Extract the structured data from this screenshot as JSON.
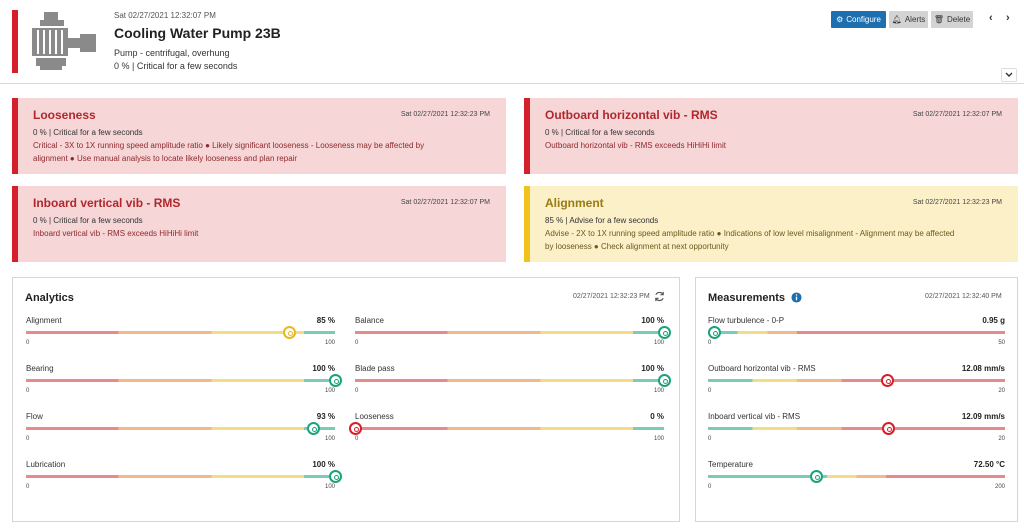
{
  "header": {
    "timestamp": "Sat 02/27/2021 12:32:07 PM",
    "title": "Cooling Water Pump 23B",
    "subtitle": "Pump - centrifugal, overhung",
    "status": "0 % | Critical for a few seconds",
    "configure_label": "Configure",
    "alerts_label": "Alerts",
    "delete_label": "Delete",
    "prev_label": "‹",
    "next_label": "›"
  },
  "alerts": [
    {
      "title": "Looseness",
      "timestamp": "Sat 02/27/2021 12:32:23 PM",
      "status": "0 % | Critical for a few seconds",
      "detail1": "Critical - 3X to 1X running speed amplitude ratio ● Likely significant looseness - Looseness may be affected by",
      "detail2": "alignment ● Use manual analysis to locate likely looseness and plan repair",
      "severity": "critical"
    },
    {
      "title": "Outboard horizontal vib - RMS",
      "timestamp": "Sat 02/27/2021 12:32:07 PM",
      "status": "0 % | Critical for a few seconds",
      "detail1": "Outboard horizontal vib - RMS exceeds HiHiHi limit",
      "detail2": "",
      "severity": "critical"
    },
    {
      "title": "Inboard vertical vib - RMS",
      "timestamp": "Sat 02/27/2021 12:32:07 PM",
      "status": "0 % | Critical for a few seconds",
      "detail1": "Inboard vertical vib - RMS exceeds HiHiHi limit",
      "detail2": "",
      "severity": "critical"
    },
    {
      "title": "Alignment",
      "timestamp": "Sat 02/27/2021 12:32:23 PM",
      "status": "85 % | Advise for a few seconds",
      "detail1": "Advise - 2X to 1X running speed amplitude ratio ● Indications of low level misalignment - Alignment may be affected",
      "detail2": "by looseness ● Check alignment at next opportunity",
      "severity": "advise"
    }
  ],
  "analytics": {
    "title": "Analytics",
    "timestamp": "02/27/2021 12:32:23 PM",
    "gauges": [
      {
        "label": "Alignment",
        "value_text": "85 %",
        "value": 85,
        "min": "0",
        "max": "100",
        "scale_max": 100,
        "knob": "yellow",
        "track": "health"
      },
      {
        "label": "Balance",
        "value_text": "100 %",
        "value": 100,
        "min": "0",
        "max": "100",
        "scale_max": 100,
        "knob": "green",
        "track": "health"
      },
      {
        "label": "Bearing",
        "value_text": "100 %",
        "value": 100,
        "min": "0",
        "max": "100",
        "scale_max": 100,
        "knob": "green",
        "track": "health"
      },
      {
        "label": "Blade pass",
        "value_text": "100 %",
        "value": 100,
        "min": "0",
        "max": "100",
        "scale_max": 100,
        "knob": "green",
        "track": "health"
      },
      {
        "label": "Flow",
        "value_text": "93 %",
        "value": 93,
        "min": "0",
        "max": "100",
        "scale_max": 100,
        "knob": "green",
        "track": "health"
      },
      {
        "label": "Looseness",
        "value_text": "0 %",
        "value": 0,
        "min": "0",
        "max": "100",
        "scale_max": 100,
        "knob": "red",
        "track": "health"
      },
      {
        "label": "Lubrication",
        "value_text": "100 %",
        "value": 100,
        "min": "0",
        "max": "100",
        "scale_max": 100,
        "knob": "green",
        "track": "health"
      }
    ]
  },
  "measurements": {
    "title": "Measurements",
    "timestamp": "02/27/2021 12:32:40 PM",
    "gauges": [
      {
        "label": "Flow turbulence - 0-P",
        "value_text": "0.95 g",
        "value": 0.95,
        "min": "0",
        "max": "50",
        "scale_max": 50,
        "knob": "green",
        "track": "flow"
      },
      {
        "label": "Outboard horizontal vib - RMS",
        "value_text": "12.08 mm/s",
        "value": 12.08,
        "min": "0",
        "max": "20",
        "scale_max": 20,
        "knob": "red",
        "track": "vib"
      },
      {
        "label": "Inboard vertical vib - RMS",
        "value_text": "12.09 mm/s",
        "value": 12.09,
        "min": "0",
        "max": "20",
        "scale_max": 20,
        "knob": "red",
        "track": "vib"
      },
      {
        "label": "Temperature",
        "value_text": "72.50 °C",
        "value": 72.5,
        "min": "0",
        "max": "200",
        "scale_max": 200,
        "knob": "green",
        "track": "temp"
      }
    ]
  },
  "colors": {
    "critical": "#d4202a",
    "advise": "#f1c21b",
    "primary": "#1d6fb0",
    "track_red": "#e88a8a",
    "track_orange": "#f2b98a",
    "track_yellow": "#f4dc83",
    "track_green": "#79cdb6",
    "knob_green": "#1aa37a",
    "knob_red": "#d4202a",
    "knob_yellow": "#e8b91e"
  }
}
